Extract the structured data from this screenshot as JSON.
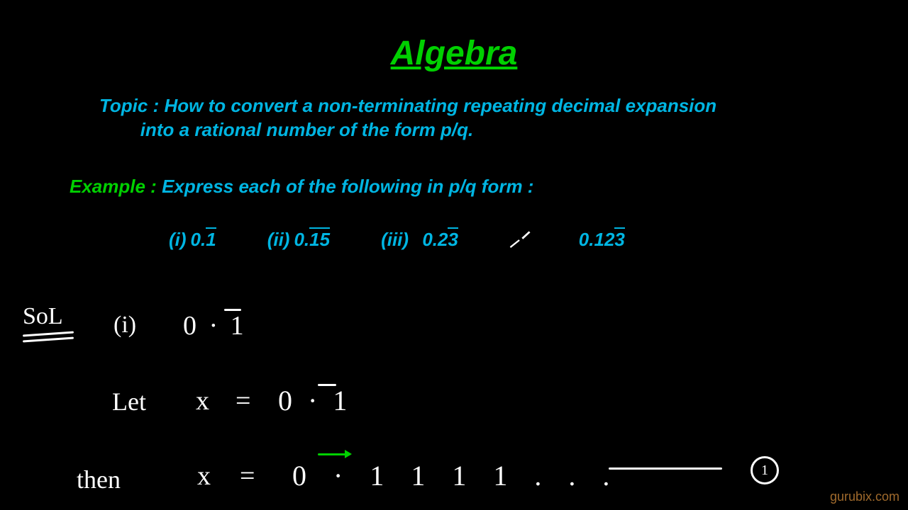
{
  "title": "Algebra",
  "topic": {
    "label": "Topic : ",
    "line1": "How to convert a non-terminating repeating decimal expansion",
    "line2": "into a rational number of the form p/q."
  },
  "example": {
    "label": "Example : ",
    "text": "Express each of the following in p/q form :"
  },
  "items": {
    "i": {
      "label": "(i)",
      "base": "0.",
      "rep": "1"
    },
    "ii": {
      "label": "(ii)",
      "base": "0.",
      "rep": "15"
    },
    "iii": {
      "label": "(iii)",
      "base": "0.2",
      "rep": "3"
    },
    "iv": {
      "label": "",
      "base": "0.12",
      "rep": "3"
    }
  },
  "cursor_mark": "⸝ᐟ",
  "solution": {
    "sol_label": "SoL",
    "part_i": "(i)",
    "zero_bar": "0 · 1",
    "let": "Let",
    "x": "x",
    "eq": "=",
    "zero_bar2": "0 · 1",
    "then": "then",
    "expansion": "0 · 1 1 1 1 . . .",
    "eqn_num": "1"
  },
  "watermark": "gurubix.com"
}
